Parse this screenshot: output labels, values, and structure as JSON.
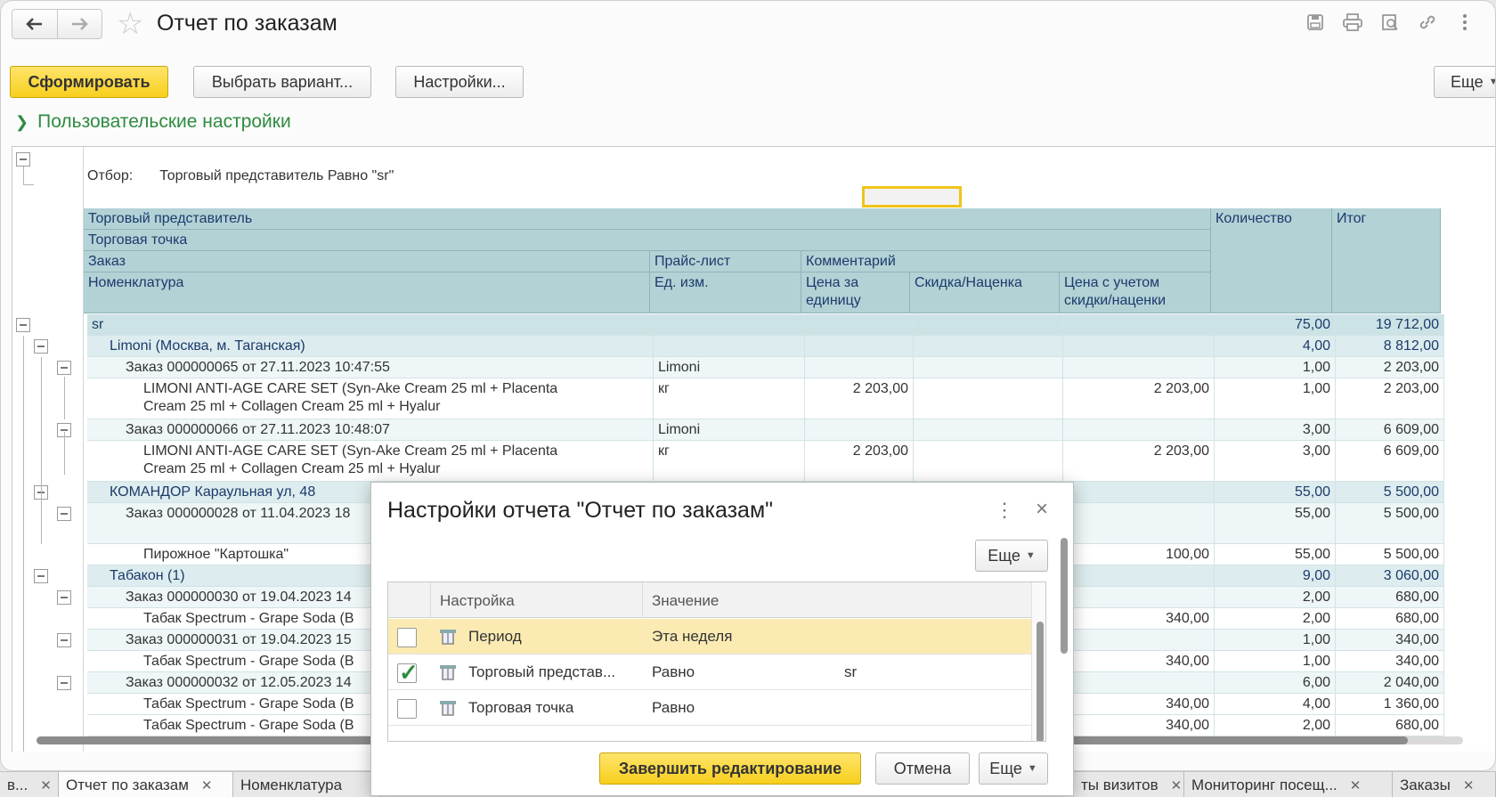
{
  "header": {
    "title": "Отчет по заказам",
    "back_icon": "arrow-left-icon",
    "forward_icon": "arrow-right-icon"
  },
  "toolbar": {
    "generate_label": "Сформировать",
    "choose_variant_label": "Выбрать вариант...",
    "settings_label": "Настройки...",
    "more_label": "Еще"
  },
  "user_settings_label": "Пользовательские настройки",
  "filter": {
    "label": "Отбор:",
    "value": "Торговый представитель Равно \"sr\""
  },
  "columns": {
    "trade_rep": "Торговый представитель",
    "trade_point": "Торговая точка",
    "order": "Заказ",
    "nomenclature": "Номенклатура",
    "price_list": "Прайс-лист",
    "unit": "Ед. изм.",
    "comment": "Комментарий",
    "unit_price": "Цена за единицу",
    "discount": "Скидка/Наценка",
    "price_with_discount": "Цена с учетом скидки/наценки",
    "quantity": "Количество",
    "total": "Итог"
  },
  "rows": [
    {
      "level": 0,
      "name": "sr",
      "pricelist": "",
      "price": "",
      "discount": "",
      "price_disc": "",
      "qty": "75,00",
      "total": "19 712,00"
    },
    {
      "level": 1,
      "name": "Limoni (Москва, м. Таганская)",
      "pricelist": "",
      "price": "",
      "discount": "",
      "price_disc": "",
      "qty": "4,00",
      "total": "8 812,00"
    },
    {
      "level": 2,
      "name": "Заказ 000000065 от 27.11.2023 10:47:55",
      "pricelist": "Limoni",
      "price": "",
      "discount": "",
      "price_disc": "",
      "qty": "1,00",
      "total": "2 203,00"
    },
    {
      "level": 3,
      "name": "LIMONI ANTI-AGE CARE SET (Syn-Ake Cream 25 ml + Placenta",
      "name2": "Cream 25 ml + Collagen Cream 25 ml + Hyalur",
      "pricelist": "кг",
      "price": "2 203,00",
      "discount": "",
      "price_disc": "2 203,00",
      "qty": "1,00",
      "total": "2 203,00"
    },
    {
      "level": 2,
      "name": "Заказ 000000066 от 27.11.2023 10:48:07",
      "pricelist": "Limoni",
      "price": "",
      "discount": "",
      "price_disc": "",
      "qty": "3,00",
      "total": "6 609,00"
    },
    {
      "level": 3,
      "name": "LIMONI ANTI-AGE CARE SET (Syn-Ake Cream 25 ml + Placenta",
      "name2": "Cream 25 ml + Collagen Cream 25 ml + Hyalur",
      "pricelist": "кг",
      "price": "2 203,00",
      "discount": "",
      "price_disc": "2 203,00",
      "qty": "3,00",
      "total": "6 609,00"
    },
    {
      "level": 1,
      "name": "КОМАНДОР Караульная ул, 48",
      "pricelist": "",
      "price": "",
      "discount": "",
      "price_disc": "",
      "qty": "55,00",
      "total": "5 500,00"
    },
    {
      "level": 2,
      "name": "Заказ 000000028 от 11.04.2023 18",
      "pricelist": "",
      "price": "",
      "discount": "",
      "price_disc": "",
      "qty": "55,00",
      "total": "5 500,00"
    },
    {
      "level": 3,
      "name": "Пирожное \"Картошка\"",
      "pricelist": "",
      "price": "",
      "discount": "",
      "price_disc": "100,00",
      "qty": "55,00",
      "total": "5 500,00"
    },
    {
      "level": 1,
      "name": "Табакон (1)",
      "pricelist": "",
      "price": "",
      "discount": "",
      "price_disc": "",
      "qty": "9,00",
      "total": "3 060,00"
    },
    {
      "level": 2,
      "name": "Заказ 000000030 от 19.04.2023 14",
      "pricelist": "",
      "price": "",
      "discount": "",
      "price_disc": "",
      "qty": "2,00",
      "total": "680,00"
    },
    {
      "level": 3,
      "name": "Табак Spectrum - Grape Soda (В",
      "pricelist": "",
      "price": "",
      "discount": "",
      "price_disc": "340,00",
      "qty": "2,00",
      "total": "680,00"
    },
    {
      "level": 2,
      "name": "Заказ 000000031 от 19.04.2023 15",
      "pricelist": "",
      "price": "",
      "discount": "",
      "price_disc": "",
      "qty": "1,00",
      "total": "340,00"
    },
    {
      "level": 3,
      "name": "Табак Spectrum - Grape Soda (В",
      "pricelist": "",
      "price": "",
      "discount": "",
      "price_disc": "340,00",
      "qty": "1,00",
      "total": "340,00"
    },
    {
      "level": 2,
      "name": "Заказ 000000032 от 12.05.2023 14",
      "pricelist": "",
      "price": "",
      "discount": "",
      "price_disc": "",
      "qty": "6,00",
      "total": "2 040,00"
    },
    {
      "level": 3,
      "name": "Табак Spectrum - Grape Soda (В",
      "pricelist": "",
      "price": "",
      "discount": "",
      "price_disc": "340,00",
      "qty": "4,00",
      "total": "1 360,00"
    },
    {
      "level": 3,
      "name": "Табак Spectrum - Grape Soda (В",
      "pricelist": "",
      "price": "",
      "discount": "",
      "price_disc": "340,00",
      "qty": "2,00",
      "total": "680,00"
    }
  ],
  "tabs": [
    {
      "label": "в...",
      "active": false
    },
    {
      "label": "Отчет по заказам",
      "active": true
    },
    {
      "label": "Номенклатура",
      "active": false
    },
    {
      "label": "ты визитов",
      "active": false
    },
    {
      "label": "Мониторинг посещ...",
      "active": false
    },
    {
      "label": "Заказы",
      "active": false
    }
  ],
  "dialog": {
    "title": "Настройки отчета \"Отчет по заказам\"",
    "more_label": "Еще",
    "col_setting": "Настройка",
    "col_value": "Значение",
    "rows": [
      {
        "checked": false,
        "name": "Период",
        "condition": "Эта неделя",
        "value": "",
        "selected": true
      },
      {
        "checked": true,
        "name": "Торговый представ...",
        "condition": "Равно",
        "value": "sr",
        "selected": false
      },
      {
        "checked": false,
        "name": "Торговая  точка",
        "condition": "Равно",
        "value": "",
        "selected": false
      }
    ],
    "finish_label": "Завершить редактирование",
    "cancel_label": "Отмена",
    "footer_more_label": "Еще"
  },
  "colors": {
    "accent_yellow": "#f7cf1d",
    "green_link": "#2e8b41",
    "header_teal": "#b2d2d6"
  }
}
